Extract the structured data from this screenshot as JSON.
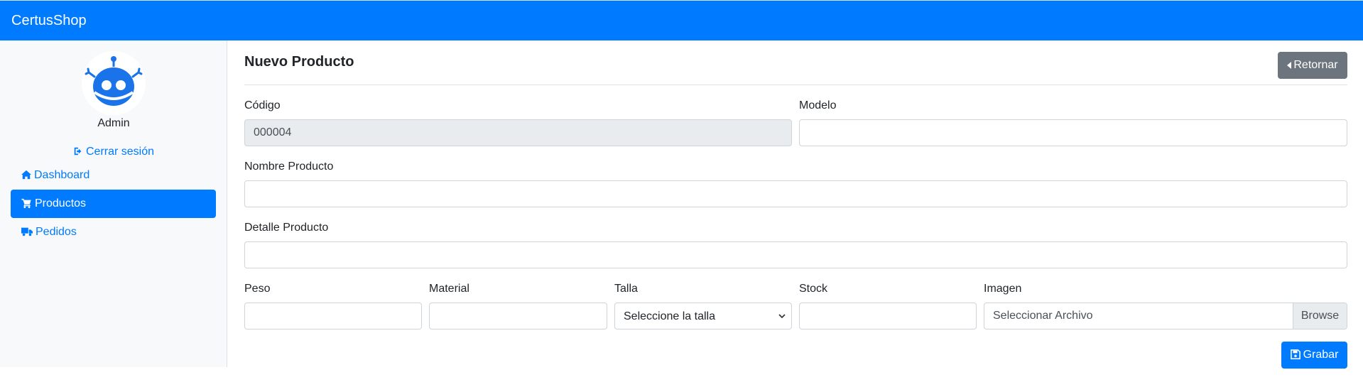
{
  "navbar": {
    "brand": "CertusShop"
  },
  "sidebar": {
    "user_name": "Admin",
    "logout_label": "Cerrar sesión",
    "items": [
      {
        "label": "Dashboard",
        "icon": "home-icon",
        "active": false
      },
      {
        "label": "Productos",
        "icon": "cart-icon",
        "active": true
      },
      {
        "label": "Pedidos",
        "icon": "truck-icon",
        "active": false
      }
    ]
  },
  "page": {
    "title": "Nuevo Producto",
    "return_label": "Retornar",
    "save_label": "Grabar"
  },
  "form": {
    "codigo": {
      "label": "Código",
      "value": "000004"
    },
    "modelo": {
      "label": "Modelo",
      "value": ""
    },
    "nombre": {
      "label": "Nombre Producto",
      "value": ""
    },
    "detalle": {
      "label": "Detalle Producto",
      "value": ""
    },
    "peso": {
      "label": "Peso",
      "value": ""
    },
    "material": {
      "label": "Material",
      "value": ""
    },
    "talla": {
      "label": "Talla",
      "selected": "Seleccione la talla"
    },
    "stock": {
      "label": "Stock",
      "value": ""
    },
    "imagen": {
      "label": "Imagen",
      "placeholder": "Seleccionar Archivo",
      "browse_label": "Browse"
    }
  },
  "colors": {
    "primary": "#007bff",
    "secondary": "#6c757d",
    "sidebar_bg": "#f8f9fa"
  }
}
